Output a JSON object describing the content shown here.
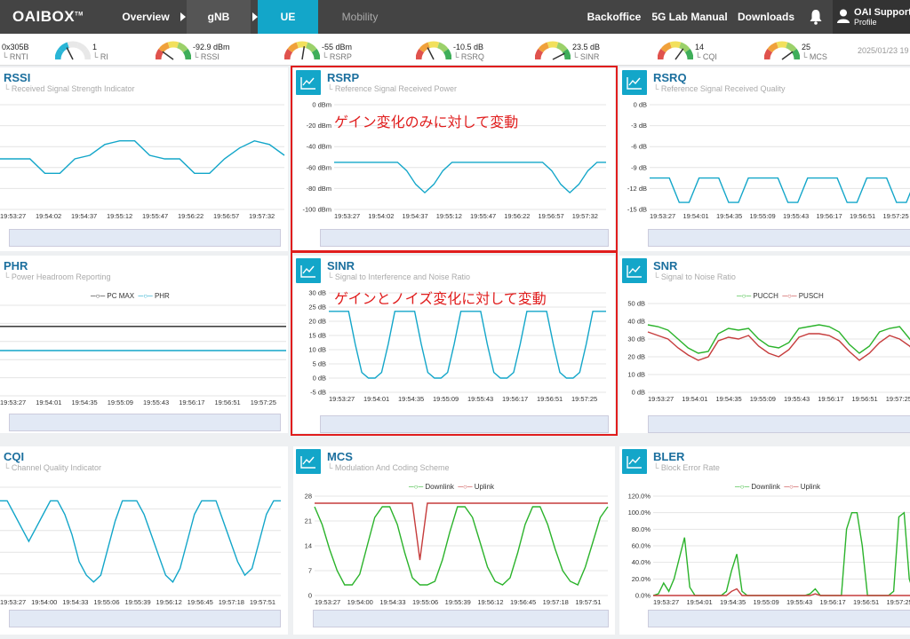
{
  "nav": {
    "logo": "OAIBOX",
    "logo_tm": "TM",
    "overview": "Overview",
    "gnb": "gNB",
    "ue": "UE",
    "mobility": "Mobility",
    "backoffice": "Backoffice",
    "lab_manual": "5G Lab Manual",
    "downloads": "Downloads",
    "user_name": "OAI Support",
    "user_sub": "Profile"
  },
  "stats": [
    {
      "value": "0x305B",
      "label": "RNTI"
    },
    {
      "value": "1",
      "label": "RI"
    },
    {
      "value": "-92.9 dBm",
      "label": "RSSI"
    },
    {
      "value": "-55 dBm",
      "label": "RSRP"
    },
    {
      "value": "-10.5 dB",
      "label": "RSRQ"
    },
    {
      "value": "23.5 dB",
      "label": "SINR"
    },
    {
      "value": "14",
      "label": "CQI"
    },
    {
      "value": "25",
      "label": "MCS"
    }
  ],
  "date": "2025/01/23 19",
  "colors": {
    "accent": "#13a6c9",
    "title": "#1b6f9e",
    "highlight": "#e01d1d",
    "green": "#2bb32b",
    "red": "#c63c3c",
    "black": "#222222"
  },
  "panels": {
    "rssi": {
      "title": "RSSI",
      "sub": "Received Signal Strength Indicator"
    },
    "rsrp": {
      "title": "RSRP",
      "sub": "Reference Signal Received Power"
    },
    "rsrq": {
      "title": "RSRQ",
      "sub": "Reference Signal Received Quality"
    },
    "phr": {
      "title": "PHR",
      "sub": "Power Headroom Reporting",
      "legend": [
        "PC MAX",
        "PHR"
      ]
    },
    "sinr": {
      "title": "SINR",
      "sub": "Signal to Interference and Noise Ratio"
    },
    "snr": {
      "title": "SNR",
      "sub": "Signal to Noise Ratio",
      "legend": [
        "PUCCH",
        "PUSCH"
      ]
    },
    "cqi": {
      "title": "CQI",
      "sub": "Channel Quality Indicator"
    },
    "mcs": {
      "title": "MCS",
      "sub": "Modulation And Coding Scheme",
      "legend": [
        "Downlink",
        "Uplink"
      ]
    },
    "bler": {
      "title": "BLER",
      "sub": "Block Error Rate",
      "legend": [
        "Downlink",
        "Uplink"
      ]
    }
  },
  "annotations": {
    "rsrp": "ゲイン変化のみに対して変動",
    "sinr": "ゲインとノイズ変化に対して変動"
  },
  "chart_data": [
    {
      "id": "rssi",
      "type": "line",
      "x": [
        "19:53:27",
        "19:54:02",
        "19:54:37",
        "19:55:12",
        "19:55:47",
        "19:56:22",
        "19:56:57",
        "19:57:32"
      ],
      "yticks": [],
      "series": [
        {
          "values": [
            -73,
            -73,
            -73,
            -77,
            -77,
            -73,
            -72,
            -69,
            -68,
            -68,
            -72,
            -73,
            -73,
            -77,
            -77,
            -73,
            -70,
            -68,
            -69,
            -72
          ]
        }
      ]
    },
    {
      "id": "rsrp",
      "type": "line",
      "x": [
        "19:53:27",
        "19:54:02",
        "19:54:37",
        "19:55:12",
        "19:55:47",
        "19:56:22",
        "19:56:57",
        "19:57:32"
      ],
      "ylim": [
        -100,
        0
      ],
      "yticks": [
        "0 dBm",
        "-20 dBm",
        "-40 dBm",
        "-60 dBm",
        "-80 dBm",
        "-100 dBm"
      ],
      "series": [
        {
          "values": [
            -55,
            -55,
            -55,
            -55,
            -55,
            -55,
            -55,
            -55,
            -63,
            -76,
            -84,
            -76,
            -63,
            -55,
            -55,
            -55,
            -55,
            -55,
            -55,
            -55,
            -55,
            -55,
            -55,
            -55,
            -63,
            -76,
            -84,
            -76,
            -63,
            -55,
            -55
          ]
        }
      ]
    },
    {
      "id": "rsrq",
      "type": "line",
      "x": [
        "19:53:27",
        "19:54:01",
        "19:54:35",
        "19:55:09",
        "19:55:43",
        "19:56:17",
        "19:56:51",
        "19:57:25"
      ],
      "ylim": [
        -15,
        0
      ],
      "yticks": [
        "0 dB",
        "-3 dB",
        "-6 dB",
        "-9 dB",
        "-12 dB",
        "-15 dB"
      ],
      "series": [
        {
          "values": [
            -10.5,
            -10.5,
            -10.5,
            -14,
            -14,
            -10.5,
            -10.5,
            -10.5,
            -14,
            -14,
            -10.5,
            -10.5,
            -10.5,
            -10.5,
            -14,
            -14,
            -10.5,
            -10.5,
            -10.5,
            -10.5,
            -14,
            -14,
            -10.5,
            -10.5,
            -10.5,
            -14,
            -14,
            -10.5
          ]
        }
      ]
    },
    {
      "id": "phr",
      "type": "line",
      "x": [
        "19:53:27",
        "19:54:01",
        "19:54:35",
        "19:55:09",
        "19:55:43",
        "19:56:17",
        "19:56:51",
        "19:57:25"
      ],
      "yticks": [],
      "series": [
        {
          "name": "PC MAX",
          "values": [
            23,
            23
          ]
        },
        {
          "name": "PHR",
          "values": [
            15,
            15
          ]
        }
      ]
    },
    {
      "id": "sinr",
      "type": "line",
      "x": [
        "19:53:27",
        "19:54:01",
        "19:54:35",
        "19:55:09",
        "19:55:43",
        "19:56:17",
        "19:56:51",
        "19:57:25"
      ],
      "ylim": [
        -5,
        30
      ],
      "yticks": [
        "30 dB",
        "25 dB",
        "20 dB",
        "15 dB",
        "10 dB",
        "5 dB",
        "0 dB",
        "-5 dB"
      ],
      "series": [
        {
          "values": [
            23.5,
            23.5,
            23.5,
            23.5,
            12,
            2,
            0,
            0,
            2,
            12,
            23.5,
            23.5,
            23.5,
            23.5,
            12,
            2,
            0,
            0,
            2,
            12,
            23.5,
            23.5,
            23.5,
            23.5,
            12,
            2,
            0,
            0,
            2,
            12,
            23.5,
            23.5,
            23.5,
            23.5,
            12,
            2,
            0,
            0,
            2,
            12,
            23.5,
            23.5,
            23.5
          ]
        }
      ]
    },
    {
      "id": "snr",
      "type": "line",
      "x": [
        "19:53:27",
        "19:54:01",
        "19:54:35",
        "19:55:09",
        "19:55:43",
        "19:56:17",
        "19:56:51",
        "19:57:25"
      ],
      "ylim": [
        0,
        50
      ],
      "yticks": [
        "50 dB",
        "40 dB",
        "30 dB",
        "20 dB",
        "10 dB",
        "0 dB"
      ],
      "series": [
        {
          "name": "PUCCH",
          "values": [
            38,
            37,
            35,
            30,
            25,
            22,
            23,
            33,
            36,
            35,
            36,
            30,
            26,
            25,
            28,
            36,
            37,
            38,
            37,
            34,
            27,
            22,
            26,
            34,
            36,
            37,
            30,
            23
          ]
        },
        {
          "name": "PUSCH",
          "values": [
            34,
            32,
            30,
            25,
            21,
            18,
            20,
            29,
            31,
            30,
            32,
            26,
            22,
            20,
            24,
            31,
            33,
            33,
            32,
            29,
            23,
            18,
            22,
            28,
            32,
            30,
            26,
            19
          ]
        }
      ]
    },
    {
      "id": "cqi",
      "type": "line",
      "x": [
        "19:53:27",
        "19:54:00",
        "19:54:33",
        "19:55:06",
        "19:55:39",
        "19:56:12",
        "19:56:45",
        "19:57:18",
        "19:57:51"
      ],
      "yticks": [],
      "series": [
        {
          "values": [
            14,
            14,
            12,
            10,
            8,
            10,
            12,
            14,
            14,
            12,
            9,
            5,
            3,
            2,
            3,
            7,
            11,
            14,
            14,
            14,
            12,
            9,
            6,
            3,
            2,
            4,
            8,
            12,
            14,
            14,
            14,
            11,
            8,
            5,
            3,
            4,
            8,
            12,
            14,
            14
          ]
        }
      ]
    },
    {
      "id": "mcs",
      "type": "line",
      "x": [
        "19:53:27",
        "19:54:00",
        "19:54:33",
        "19:55:06",
        "19:55:39",
        "19:56:12",
        "19:56:45",
        "19:57:18",
        "19:57:51"
      ],
      "ylim": [
        0,
        28
      ],
      "yticks": [
        "28",
        "21",
        "14",
        "7",
        "0"
      ],
      "series": [
        {
          "name": "Downlink",
          "values": [
            25,
            20,
            13,
            7,
            3,
            3,
            6,
            14,
            22,
            25,
            25,
            20,
            12,
            5,
            3,
            3,
            4,
            10,
            18,
            25,
            25,
            22,
            15,
            8,
            4,
            3,
            5,
            12,
            20,
            25,
            25,
            20,
            13,
            7,
            4,
            3,
            8,
            15,
            22,
            25
          ]
        },
        {
          "name": "Uplink",
          "values": [
            26,
            26,
            26,
            26,
            26,
            26,
            26,
            26,
            26,
            26,
            26,
            26,
            26,
            26,
            10,
            26,
            26,
            26,
            26,
            26,
            26,
            26,
            26,
            26,
            26,
            26,
            26,
            26,
            26,
            26,
            26,
            26,
            26,
            26,
            26,
            26,
            26,
            26,
            26,
            26
          ]
        }
      ]
    },
    {
      "id": "bler",
      "type": "line",
      "x": [
        "19:53:27",
        "19:54:01",
        "19:54:35",
        "19:55:09",
        "19:55:43",
        "19:56:17",
        "19:56:51",
        "19:57:25"
      ],
      "ylim": [
        0,
        120
      ],
      "yticks": [
        "120.0%",
        "100.0%",
        "80.0%",
        "60.0%",
        "40.0%",
        "20.0%",
        "0.0%"
      ],
      "series": [
        {
          "name": "Downlink",
          "values": [
            0,
            2,
            15,
            5,
            20,
            45,
            70,
            10,
            0,
            0,
            0,
            0,
            0,
            0,
            5,
            30,
            50,
            5,
            0,
            0,
            0,
            0,
            0,
            0,
            0,
            0,
            0,
            0,
            0,
            0,
            2,
            8,
            0,
            0,
            0,
            0,
            0,
            80,
            100,
            100,
            60,
            0,
            0,
            0,
            0,
            0,
            5,
            95,
            100,
            20,
            0,
            0
          ]
        },
        {
          "name": "Uplink",
          "values": [
            0,
            0,
            0,
            0,
            0,
            0,
            0,
            0,
            0,
            0,
            0,
            0,
            0,
            0,
            0,
            5,
            8,
            0,
            0,
            0,
            0,
            0,
            0,
            0,
            0,
            0,
            0,
            0,
            0,
            0,
            0,
            2,
            0,
            0,
            0,
            0,
            0,
            0,
            0,
            0,
            0,
            0,
            0,
            0,
            0,
            0,
            0,
            0,
            0,
            0,
            0,
            0
          ]
        }
      ]
    }
  ]
}
